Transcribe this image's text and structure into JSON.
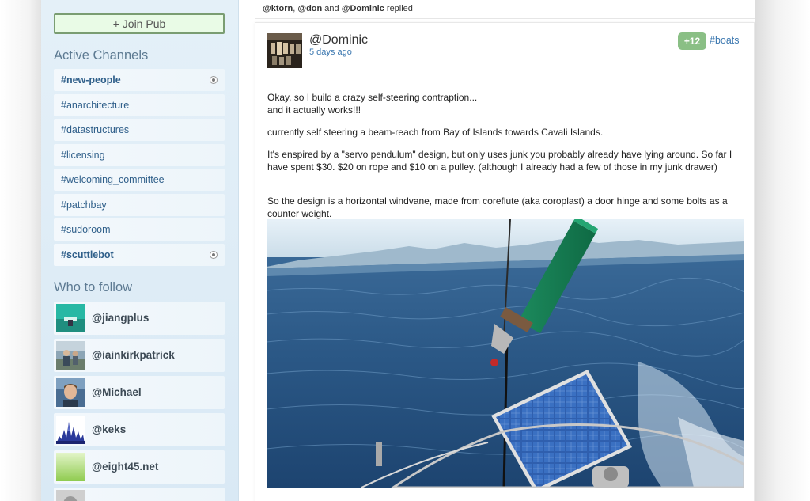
{
  "sidebar": {
    "join_pub_label": "+ Join Pub",
    "active_channels_title": "Active Channels",
    "channels": [
      {
        "label": "#new-people"
      },
      {
        "label": "#anarchitecture"
      },
      {
        "label": "#datastructures"
      },
      {
        "label": "#licensing"
      },
      {
        "label": "#welcoming_committee"
      },
      {
        "label": "#patchbay"
      },
      {
        "label": "#sudoroom"
      },
      {
        "label": "#scuttlebot"
      }
    ],
    "who_to_follow_title": "Who to follow",
    "follows": [
      {
        "name": "@jiangplus"
      },
      {
        "name": "@iainkirkpatrick"
      },
      {
        "name": "@Michael"
      },
      {
        "name": "@keks"
      },
      {
        "name": "@eight45.net"
      }
    ]
  },
  "thread": {
    "replied_user1": "@ktorn",
    "sep1": ", ",
    "replied_user2": "@don",
    "sep2": " and ",
    "replied_user3": "@Dominic",
    "replied_suffix": " replied"
  },
  "post": {
    "author": "@Dominic",
    "time": "5 days ago",
    "votes": "+12",
    "channel": "#boats",
    "p1_line1": "Okay, so I build a crazy self-steering contraption...",
    "p1_line2": "and it actually works!!!",
    "p2": "currently self steering a beam-reach from Bay of Islands towards Cavali Islands.",
    "p3": "It's enspired by a \"servo pendulum\" design, but only uses junk you probably already have lying around. So far I have spent $30. $20 on rope and $10 on a pulley. (although I already had a few of those in my junk drawer)",
    "p4": "So the design is a horizontal windvane, made from coreflute (aka coroplast) a door hinge and some bolts as a counter weight."
  },
  "colors": {
    "link": "#3c78b0",
    "vote_badge": "#8abf85",
    "join_button_bg": "#e9fbe6",
    "sidebar_bg": "#dbeaf6"
  }
}
